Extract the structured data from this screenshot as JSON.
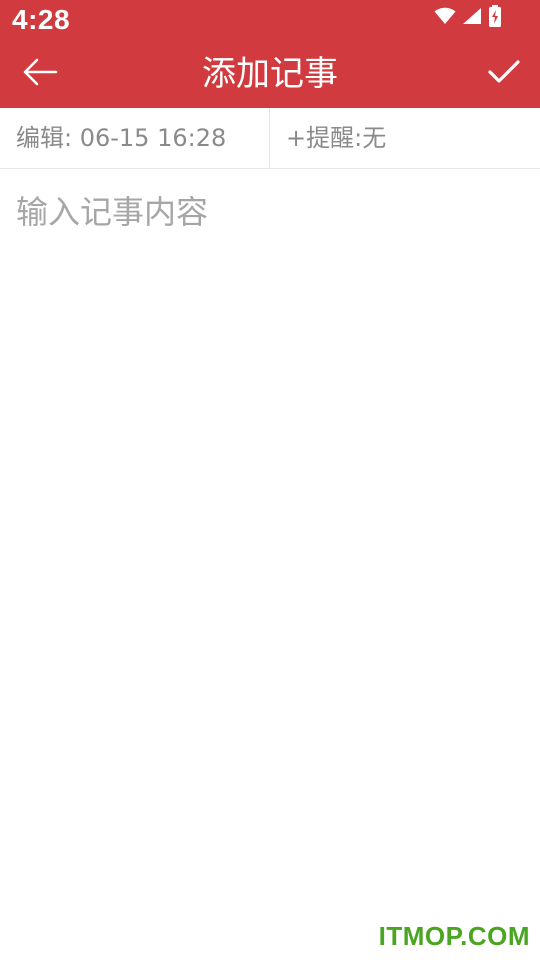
{
  "status_bar": {
    "time": "4:28",
    "icons": [
      "wifi-icon",
      "signal-icon",
      "battery-charging-icon"
    ]
  },
  "toolbar": {
    "title": "添加记事",
    "back_icon": "arrow-left-icon",
    "confirm_icon": "check-icon"
  },
  "info": {
    "edit_time": "编辑: 06-15 16:28",
    "reminder": "+提醒:无"
  },
  "editor": {
    "placeholder": "输入记事内容",
    "value": ""
  },
  "watermark": "ITMOP.COM",
  "colors": {
    "accent": "#d13b3f",
    "watermark": "#4aa620"
  }
}
